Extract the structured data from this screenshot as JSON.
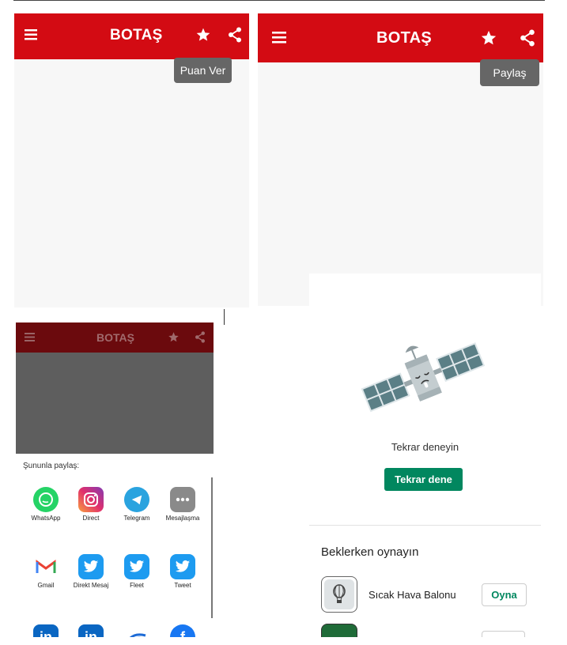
{
  "panel1": {
    "title": "BOTAŞ",
    "tooltip": "Puan Ver"
  },
  "panel2": {
    "title": "BOTAŞ",
    "tooltip": "Paylaş"
  },
  "panel3": {
    "title": "BOTAŞ",
    "share_header": "Şununla paylaş:",
    "targets": [
      {
        "label": "WhatsApp",
        "icon": "whatsapp-icon",
        "color": "#25d366"
      },
      {
        "label": "Direct",
        "icon": "instagram-icon",
        "color": "#c13584"
      },
      {
        "label": "Telegram",
        "icon": "telegram-icon",
        "color": "#2aa3df"
      },
      {
        "label": "Mesajlaşma",
        "icon": "messages-icon",
        "color": "#8a8a8a"
      },
      {
        "label": "Gmail",
        "icon": "gmail-icon",
        "color": "#ea4335"
      },
      {
        "label": "Direkt Mesaj",
        "icon": "twitter-icon",
        "color": "#1d9bf0"
      },
      {
        "label": "Fleet",
        "icon": "twitter-icon",
        "color": "#1d9bf0"
      },
      {
        "label": "Tweet",
        "icon": "twitter-icon",
        "color": "#1d9bf0"
      }
    ],
    "partial_row": [
      {
        "icon": "linkedin-icon",
        "text": "in",
        "color": "#0a66c2"
      },
      {
        "icon": "linkedin-icon",
        "text": "in",
        "color": "#0a66c2"
      },
      {
        "icon": "hoop-icon",
        "text": "",
        "color": "#1d6bd6"
      },
      {
        "icon": "facebook-icon",
        "text": "f",
        "color": "#1877f2"
      }
    ]
  },
  "panel4": {
    "error_text": "Tekrar deneyin",
    "retry_button": "Tekrar dene",
    "section_title": "Beklerken oynayın",
    "games": [
      {
        "name": "Sıcak Hava Balonu",
        "button": "Oyna"
      }
    ]
  }
}
